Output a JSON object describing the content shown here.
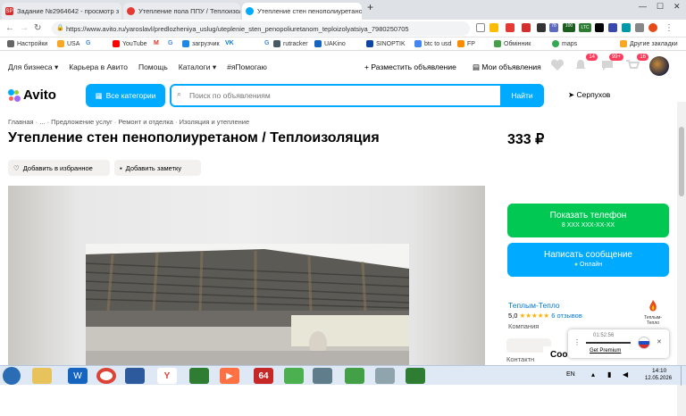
{
  "browser": {
    "tabs": [
      {
        "favicon": "SP",
        "title": "Задание №2964642 - просмотр з"
      },
      {
        "favicon": "",
        "title": "Утепление пола ППУ / Теплоизол"
      },
      {
        "favicon": "",
        "title": "Утепление стен пенополиуретано"
      }
    ],
    "new_tab": "+",
    "url": "https://www.avito.ru/yaroslavl/predlozheniya_uslug/uteplenie_sten_penopoliuretanom_teploizolyatsiya_7980250705",
    "ext_badges": {
      "ltc": "LTC",
      "ltc_val": "574",
      "b1": "78",
      "b2": "100"
    },
    "bookmarks": [
      "Настройки",
      "USA",
      "G",
      "YouTube",
      "M",
      "G",
      "загрузчик",
      "VK",
      "G",
      "rutracker",
      "UAKino",
      "SINOPTIK",
      "btc to usd",
      "FP",
      "Обмінник",
      "maps"
    ],
    "bookmarks_other": "Другие закладки"
  },
  "header": {
    "nav": [
      "Для бизнеса",
      "Карьера в Авито",
      "Помощь",
      "Каталоги",
      "#яПомогаю"
    ],
    "post_ad": "+ Разместить объявление",
    "my_ads": "Мои объявления",
    "badge_favorites": "14",
    "badge_messages": "99+",
    "badge_cart": "16",
    "logo": "Avito",
    "categories_label": "Все категории",
    "search_placeholder": "Поиск по объявлениям",
    "search_button": "Найти",
    "city": "Серпухов",
    "brand_colors": [
      "#00aaff",
      "#97cf26",
      "#ff6163",
      "#a169f7"
    ]
  },
  "breadcrumbs": [
    "Главная",
    "...",
    "Предложение услуг",
    "Ремонт и отделка",
    "Изоляция и утепление"
  ],
  "listing": {
    "title": "Утепление стен пенополиуретаном / Теплоизоляция",
    "price": "333 ₽",
    "add_favorite": "Добавить в избранное",
    "add_note": "Добавить заметку"
  },
  "contact": {
    "show_phone": "Показать телефон",
    "phone_masked": "8 XXX XXX-XX-XX",
    "write_message": "Написать сообщение",
    "online": "Онлайн",
    "seller_name": "Теплым-Тепло",
    "rating": "5,0",
    "stars": "★★★★★",
    "reviews": "6 отзывов",
    "seller_type": "Компания",
    "logo_text": "Теплым-Тепло",
    "contact_person": "Контактн",
    "cookie_partial": "Coo"
  },
  "vpn_widget": {
    "timer": "01:52:56",
    "premium": "Get Premium",
    "close": "✕"
  },
  "taskbar": {
    "lang": "EN",
    "time": "14:10",
    "date": "12.05.2026",
    "app_64": "64"
  }
}
